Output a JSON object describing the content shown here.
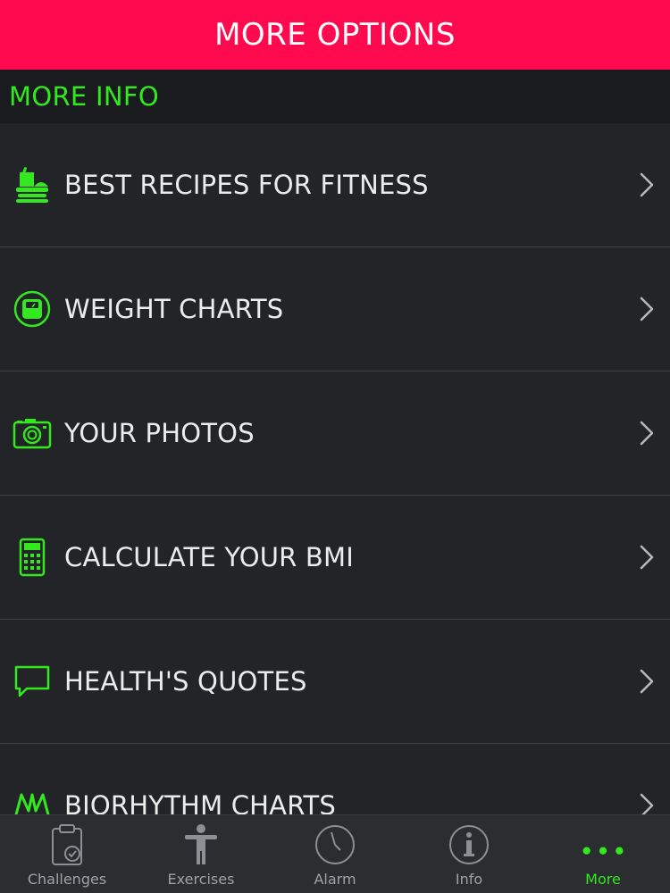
{
  "header": {
    "title": "MORE OPTIONS"
  },
  "section": {
    "title": "MORE INFO"
  },
  "menu": {
    "items": [
      {
        "label": "BEST RECIPES FOR FITNESS",
        "icon": "food-icon"
      },
      {
        "label": "WEIGHT CHARTS",
        "icon": "scale-icon"
      },
      {
        "label": "YOUR PHOTOS",
        "icon": "camera-icon"
      },
      {
        "label": "CALCULATE YOUR BMI",
        "icon": "calculator-icon"
      },
      {
        "label": "HEALTH'S QUOTES",
        "icon": "speech-bubble-icon"
      },
      {
        "label": "BIORHYTHM CHARTS",
        "icon": "biorhythm-icon"
      }
    ]
  },
  "tabbar": {
    "tabs": [
      {
        "label": "Challenges",
        "icon": "clipboard-check-icon"
      },
      {
        "label": "Exercises",
        "icon": "person-icon"
      },
      {
        "label": "Alarm",
        "icon": "clock-icon"
      },
      {
        "label": "Info",
        "icon": "info-icon"
      },
      {
        "label": "More",
        "icon": "more-dots-icon",
        "active": true
      }
    ]
  },
  "colors": {
    "header": "#ff0a4f",
    "accent": "#33e81f",
    "background": "#232428",
    "section_background": "#1a1b1e",
    "tabbar_background": "#2c2d31"
  }
}
